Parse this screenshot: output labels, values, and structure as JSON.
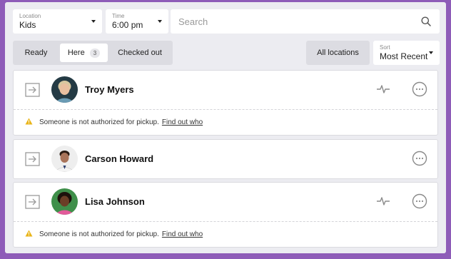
{
  "filters": {
    "location": {
      "label": "Location",
      "value": "Kids"
    },
    "time": {
      "label": "Time",
      "value": "6:00 pm"
    },
    "search_placeholder": "Search"
  },
  "tabs": [
    {
      "label": "Ready"
    },
    {
      "label": "Here",
      "count": "3",
      "active": true
    },
    {
      "label": "Checked out"
    }
  ],
  "all_locations_label": "All locations",
  "sort": {
    "label": "Sort",
    "value": "Most Recent"
  },
  "people": [
    {
      "name": "Troy Myers",
      "activity_icon": "pulse-icon",
      "warning": true
    },
    {
      "name": "Carson Howard",
      "warning": false
    },
    {
      "name": "Lisa Johnson",
      "activity_icon": "pulse-icon",
      "warning": true
    }
  ],
  "warning": {
    "text": "Someone is not authorized for pickup.",
    "link": "Find out who"
  },
  "colors": {
    "background": "#8e5cb8",
    "panel": "#ececf1",
    "warning_icon": "#e9b51a"
  }
}
